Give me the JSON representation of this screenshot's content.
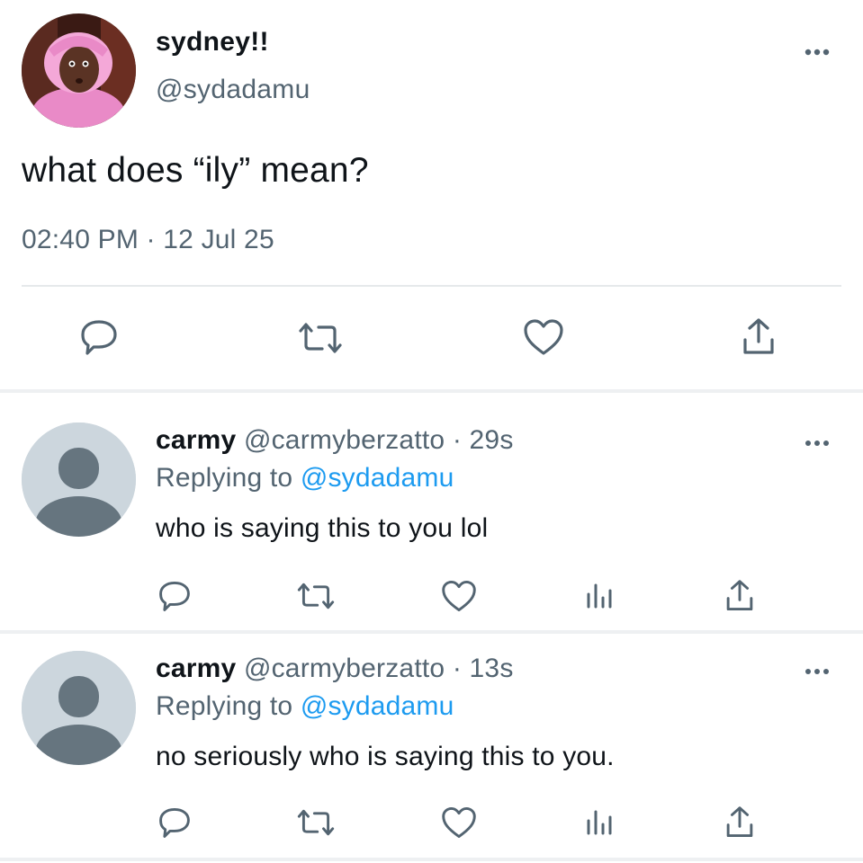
{
  "main_tweet": {
    "display_name": "sydney!!",
    "handle": "@sydadamu",
    "text": "what does “ily” mean?",
    "timestamp": "02:40 PM · 12 Jul 25",
    "actions": [
      "reply-icon",
      "retweet-icon",
      "like-icon",
      "share-icon"
    ]
  },
  "replies": [
    {
      "display_name": "carmy",
      "handle": "@carmyberzatto",
      "time_sep": " · ",
      "time": "29s",
      "replying_prefix": "Replying to ",
      "replying_to": "@sydadamu",
      "text": "who is saying this to you lol"
    },
    {
      "display_name": "carmy",
      "handle": "@carmyberzatto",
      "time_sep": " · ",
      "time": "13s",
      "replying_prefix": "Replying to ",
      "replying_to": "@sydadamu",
      "text": "no seriously who is saying this to you."
    }
  ],
  "colors": {
    "text": "#0f1419",
    "secondary": "#536471",
    "link": "#1d9bf0",
    "divider": "#eef0f2",
    "default_avatar_bg": "#ccd6dd",
    "default_avatar_fg": "#66757f"
  }
}
